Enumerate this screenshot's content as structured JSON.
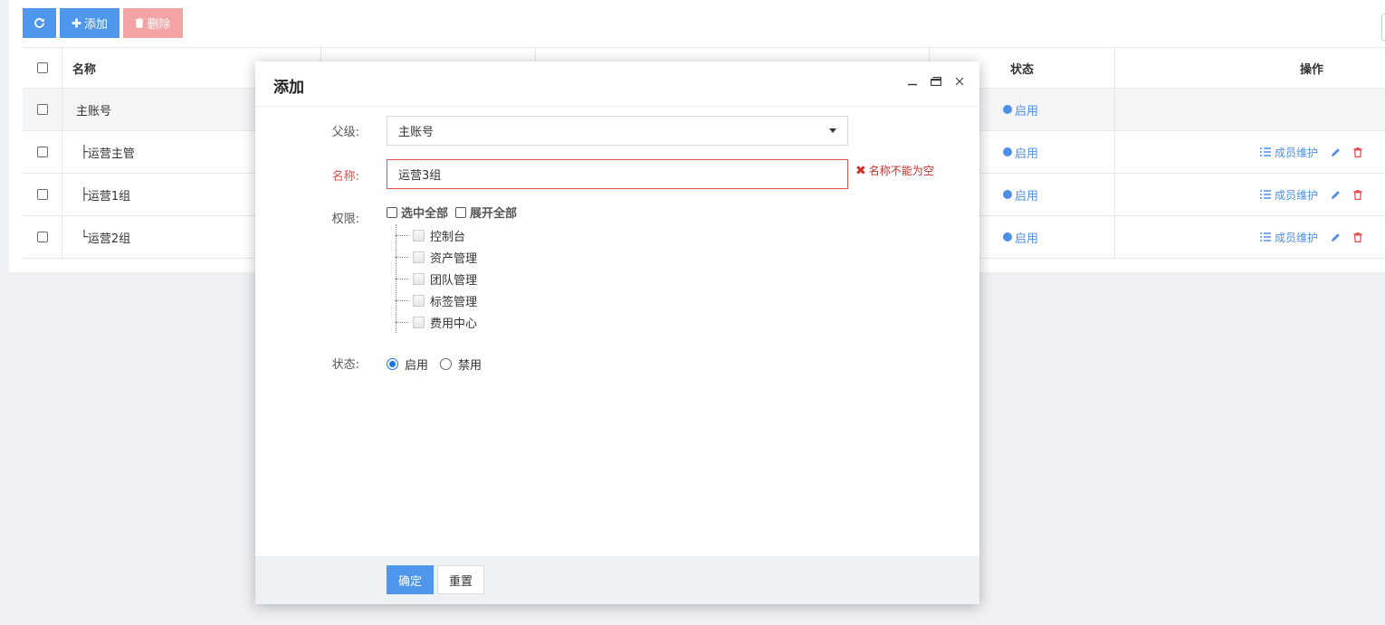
{
  "toolbar": {
    "refresh_icon": "refresh-icon",
    "add_label": "添加",
    "delete_label": "删除"
  },
  "table": {
    "headers": {
      "name": "名称",
      "status": "状态",
      "operation": "操作"
    },
    "rows": [
      {
        "prefix": "",
        "name": "主账号",
        "status": "启用",
        "has_ops": false
      },
      {
        "prefix": "├",
        "name": "运营主管",
        "status": "启用",
        "has_ops": true
      },
      {
        "prefix": "├",
        "name": "运营1组",
        "status": "启用",
        "has_ops": true
      },
      {
        "prefix": "└",
        "name": "运营2组",
        "status": "启用",
        "has_ops": true
      }
    ],
    "member_label": "成员维护"
  },
  "modal": {
    "title": "添加",
    "parent": {
      "label": "父级:",
      "value": "主账号"
    },
    "name": {
      "label": "名称:",
      "value": "运营3组",
      "error": "名称不能为空"
    },
    "permissions": {
      "label": "权限:",
      "select_all": "选中全部",
      "expand_all": "展开全部",
      "nodes": [
        "控制台",
        "资产管理",
        "团队管理",
        "标签管理",
        "费用中心"
      ]
    },
    "status": {
      "label": "状态:",
      "options": [
        "启用",
        "禁用"
      ],
      "selected": "启用"
    },
    "footer": {
      "confirm": "确定",
      "reset": "重置"
    }
  },
  "colors": {
    "primary": "#4e97ec",
    "danger": "#d9534f",
    "delete_button": "#f3a3a3",
    "status_blue": "#4e8fe6"
  }
}
